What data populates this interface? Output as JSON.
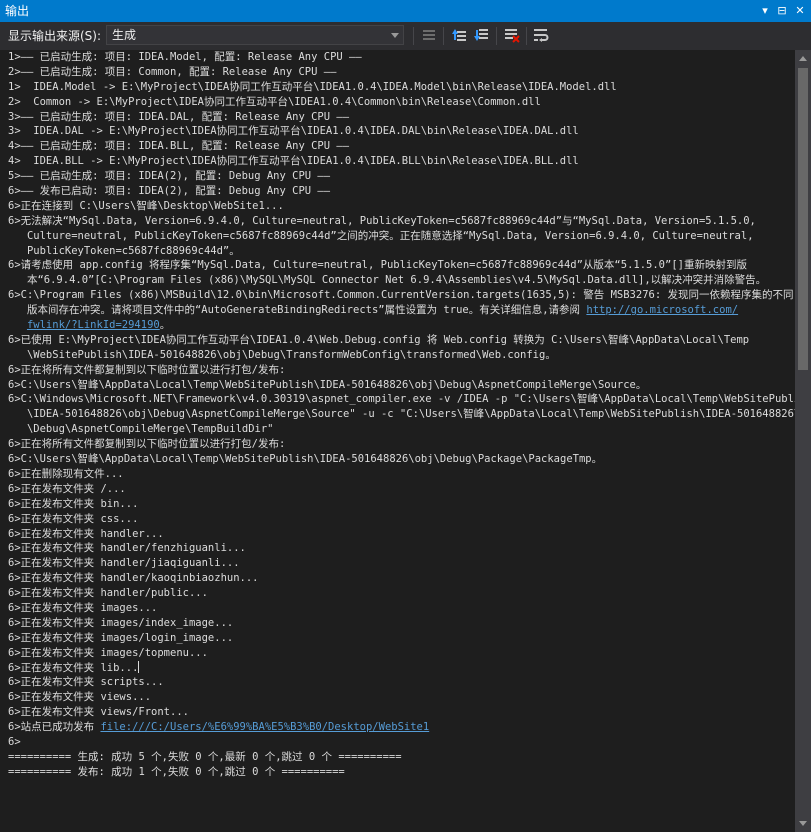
{
  "window": {
    "title": "输出",
    "dropdown_label": "▾",
    "pin_label": "⊟",
    "close_label": "✕"
  },
  "toolbar": {
    "source_label": "显示输出来源(S):",
    "source_value": "生成"
  },
  "colors": {
    "accent": "#007acc",
    "background": "#1e1e1e",
    "text": "#dcdcdc",
    "link": "#569cd6"
  },
  "icons": [
    "go-to-previous-icon",
    "go-to-next-up-icon",
    "go-to-next-down-icon",
    "clear-all-icon",
    "toggle-word-wrap-icon"
  ],
  "output_lines": [
    [
      "1>—— 已启动生成: 项目: IDEA.Model, 配置: Release Any CPU ——"
    ],
    [
      "2>—— 已启动生成: 项目: Common, 配置: Release Any CPU ——"
    ],
    [
      "1>  IDEA.Model -> E:\\MyProject\\IDEA协同工作互动平台\\IDEA1.0.4\\IDEA.Model\\bin\\Release\\IDEA.Model.dll"
    ],
    [
      "2>  Common -> E:\\MyProject\\IDEA协同工作互动平台\\IDEA1.0.4\\Common\\bin\\Release\\Common.dll"
    ],
    [
      "3>—— 已启动生成: 项目: IDEA.DAL, 配置: Release Any CPU ——"
    ],
    [
      "3>  IDEA.DAL -> E:\\MyProject\\IDEA协同工作互动平台\\IDEA1.0.4\\IDEA.DAL\\bin\\Release\\IDEA.DAL.dll"
    ],
    [
      "4>—— 已启动生成: 项目: IDEA.BLL, 配置: Release Any CPU ——"
    ],
    [
      "4>  IDEA.BLL -> E:\\MyProject\\IDEA协同工作互动平台\\IDEA1.0.4\\IDEA.BLL\\bin\\Release\\IDEA.BLL.dll"
    ],
    [
      "5>—— 已启动生成: 项目: IDEA(2), 配置: Debug Any CPU ——"
    ],
    [
      "6>—— 发布已启动: 项目: IDEA(2), 配置: Debug Any CPU ——"
    ],
    [
      "6>正在连接到 C:\\Users\\智峰\\Desktop\\WebSite1..."
    ],
    [
      "6>无法解决“MySql.Data, Version=6.9.4.0, Culture=neutral, PublicKeyToken=c5687fc88969c44d”与“MySql.Data, Version=5.1.5.0,"
    ],
    [
      "   Culture=neutral, PublicKeyToken=c5687fc88969c44d”之间的冲突。正在随意选择“MySql.Data, Version=6.9.4.0, Culture=neutral,"
    ],
    [
      "   PublicKeyToken=c5687fc88969c44d”。"
    ],
    [
      "6>请考虑使用 app.config 将程序集“MySql.Data, Culture=neutral, PublicKeyToken=c5687fc88969c44d”从版本“5.1.5.0”[]重新映射到版"
    ],
    [
      "   本“6.9.4.0”[C:\\Program Files (x86)\\MySQL\\MySQL Connector Net 6.9.4\\Assemblies\\v4.5\\MySql.Data.dll],以解决冲突并消除警告。"
    ],
    [
      "6>C:\\Program Files (x86)\\MSBuild\\12.0\\bin\\Microsoft.Common.CurrentVersion.targets(1635,5): 警告 MSB3276: 发现同一依赖程序集的不同"
    ],
    [
      "   版本间存在冲突。请将项目文件中的“AutoGenerateBindingRedirects”属性设置为 true。有关详细信息,请参阅 ",
      "http://go.microsoft.com/"
    ],
    [
      "   ",
      "fwlink/?LinkId=294190",
      "。"
    ],
    [
      "6>已使用 E:\\MyProject\\IDEA协同工作互动平台\\IDEA1.0.4\\Web.Debug.config 将 Web.config 转换为 C:\\Users\\智峰\\AppData\\Local\\Temp"
    ],
    [
      "   \\WebSitePublish\\IDEA-501648826\\obj\\Debug\\TransformWebConfig\\transformed\\Web.config。"
    ],
    [
      "6>正在将所有文件都复制到以下临时位置以进行打包/发布:"
    ],
    [
      "6>C:\\Users\\智峰\\AppData\\Local\\Temp\\WebSitePublish\\IDEA-501648826\\obj\\Debug\\AspnetCompileMerge\\Source。"
    ],
    [
      "6>C:\\Windows\\Microsoft.NET\\Framework\\v4.0.30319\\aspnet_compiler.exe -v /IDEA -p \"C:\\Users\\智峰\\AppData\\Local\\Temp\\WebSitePublish"
    ],
    [
      "   \\IDEA-501648826\\obj\\Debug\\AspnetCompileMerge\\Source\" -u -c \"C:\\Users\\智峰\\AppData\\Local\\Temp\\WebSitePublish\\IDEA-501648826\\obj"
    ],
    [
      "   \\Debug\\AspnetCompileMerge\\TempBuildDir\""
    ],
    [
      "6>正在将所有文件都复制到以下临时位置以进行打包/发布:"
    ],
    [
      "6>C:\\Users\\智峰\\AppData\\Local\\Temp\\WebSitePublish\\IDEA-501648826\\obj\\Debug\\Package\\PackageTmp。"
    ],
    [
      "6>正在删除现有文件..."
    ],
    [
      "6>正在发布文件夹 /..."
    ],
    [
      "6>正在发布文件夹 bin..."
    ],
    [
      "6>正在发布文件夹 css..."
    ],
    [
      "6>正在发布文件夹 handler..."
    ],
    [
      "6>正在发布文件夹 handler/fenzhiguanli..."
    ],
    [
      "6>正在发布文件夹 handler/jiaqiguanli..."
    ],
    [
      "6>正在发布文件夹 handler/kaoqinbiaozhun..."
    ],
    [
      "6>正在发布文件夹 handler/public..."
    ],
    [
      "6>正在发布文件夹 images..."
    ],
    [
      "6>正在发布文件夹 images/index_image..."
    ],
    [
      "6>正在发布文件夹 images/login_image..."
    ],
    [
      "6>正在发布文件夹 images/topmenu..."
    ],
    [
      "6>正在发布文件夹 lib..."
    ],
    [
      "6>正在发布文件夹 scripts..."
    ],
    [
      "6>正在发布文件夹 views..."
    ],
    [
      "6>正在发布文件夹 views/Front..."
    ],
    [
      "6>站点已成功发布 ",
      "file:///C:/Users/%E6%99%BA%E5%B3%B0/Desktop/WebSite1"
    ],
    [
      "6>"
    ],
    [
      "========== 生成: 成功 5 个,失败 0 个,最新 0 个,跳过 0 个 =========="
    ],
    [
      "========== 发布: 成功 1 个,失败 0 个,跳过 0 个 =========="
    ]
  ]
}
